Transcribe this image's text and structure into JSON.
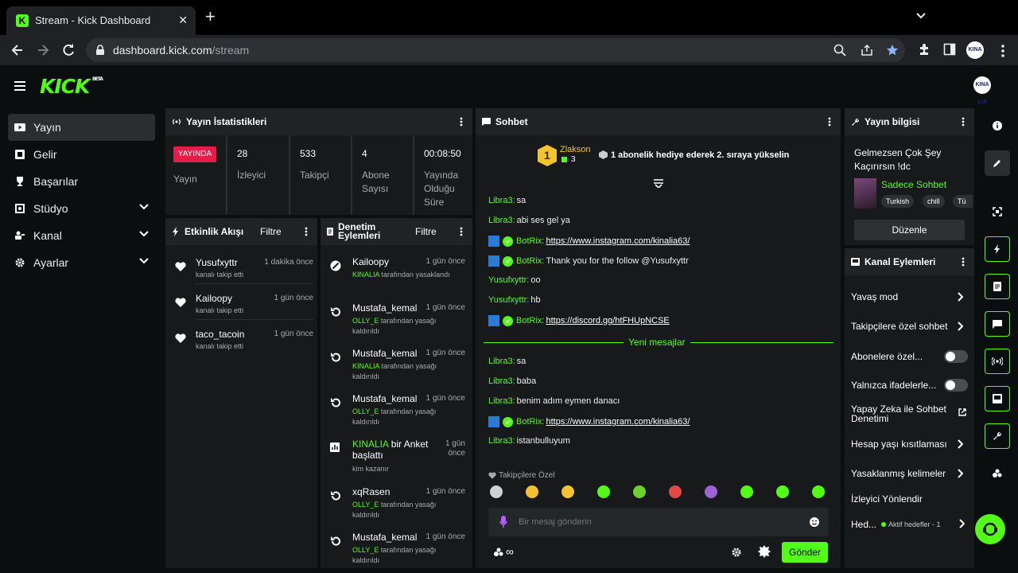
{
  "browser": {
    "tab_title": "Stream - Kick Dashboard",
    "tab_favicon": "K",
    "url_host": "dashboard.kick.com",
    "url_path": "/stream",
    "profile_initials": "KINA LIA"
  },
  "app": {
    "logo": "KICK",
    "logo_badge": "BETA",
    "avatar_initials": "KINA LIA",
    "accent": "#53fc18"
  },
  "sidebar": {
    "items": [
      {
        "label": "Yayın",
        "icon": "broadcast-icon"
      },
      {
        "label": "Gelir",
        "icon": "wallet-icon"
      },
      {
        "label": "Başarılar",
        "icon": "trophy-icon"
      },
      {
        "label": "Stüdyo",
        "icon": "studio-icon"
      },
      {
        "label": "Kanal",
        "icon": "users-icon"
      },
      {
        "label": "Ayarlar",
        "icon": "gear-icon"
      }
    ]
  },
  "stats": {
    "title": "Yayın İstatistikleri",
    "live_badge": "YAYINDA",
    "live_label": "Yayın",
    "viewers": "28",
    "viewers_label": "İzleyici",
    "followers": "533",
    "followers_label": "Takipçi",
    "subs": "4",
    "subs_label": "Abone Sayısı",
    "uptime": "00:08:50",
    "uptime_label": "Yayında Olduğu Süre"
  },
  "activity": {
    "title": "Etkinlik Akışı",
    "filter": "Filtre",
    "items": [
      {
        "name": "Yusufxyttr",
        "time": "1 dakika önce",
        "sub": "kanalı takip etti"
      },
      {
        "name": "Kailoopy",
        "time": "1 gün önce",
        "sub": "kanalı takip etti"
      },
      {
        "name": "taco_tacoin",
        "time": "1 gün önce",
        "sub": "kanalı takip etti"
      }
    ]
  },
  "moderation": {
    "title_line1": "Denetim",
    "title_line2": "Eylemleri",
    "filter": "Filtre",
    "items": [
      {
        "name": "Kailoopy",
        "time": "1 gün önce",
        "actor": "KINALIA",
        "action": " tarafından yasaklandı"
      },
      {
        "name": "Mustafa_kemal",
        "time": "1 gün önce",
        "actor": "OLLY_E",
        "action": " tarafından yasağı kaldırıldı"
      },
      {
        "name": "Mustafa_kemal",
        "time": "1 gün önce",
        "actor": "KINALIA",
        "action": " tarafından yasağı kaldırıldı"
      },
      {
        "name": "Mustafa_kemal",
        "time": "1 gün önce",
        "actor": "OLLY_E",
        "action": " tarafından yasağı kaldırıldı"
      },
      {
        "name_actor": "KINALIA",
        "name_rest": " bir Anket başlattı",
        "time": "1 gün önce",
        "sub": "kim kazanır"
      },
      {
        "name": "xqRasen",
        "time": "1 gün önce",
        "actor": "OLLY_E",
        "action": " tarafından yasağı kaldırıldı"
      },
      {
        "name": "Mustafa_kemal",
        "time": "1 gün önce",
        "actor": "OLLY_E",
        "action": " tarafından yasağı kaldırıldı"
      }
    ]
  },
  "chat": {
    "title": "Sohbet",
    "pinned_user": "Zlakson",
    "pinned_count": "3",
    "pinned_rank": "1",
    "pinned_msg": "1 abonelik hediye ederek 2. sıraya yükselin",
    "new_messages": "Yeni mesajlar",
    "followers_only": "Takipçilere Özel",
    "placeholder": "Bir mesaj gönderin",
    "send": "Gönder",
    "messages": [
      {
        "user": "Libra3:",
        "text": " sa"
      },
      {
        "user": "Libra3:",
        "text": " abi ses gel ya"
      },
      {
        "user": "BotRix:",
        "link": "https://www.instagram.com/kinalia63/",
        "bot": true
      },
      {
        "user": "BotRix:",
        "text": " Thank you for the follow @Yusufxyttr",
        "bot": true
      },
      {
        "user": "Yusufxyttr:",
        "text": " oo"
      },
      {
        "user": "Yusufxyttr:",
        "text": " hb"
      },
      {
        "user": "BotRix:",
        "link": "https://discord.gg/htFHUpNCSE",
        "bot": true
      },
      {
        "user": "Libra3:",
        "text": " sa"
      },
      {
        "user": "Libra3:",
        "text": " baba"
      },
      {
        "user": "Libra3:",
        "text": " benim adım eymen danacı"
      },
      {
        "user": "BotRix:",
        "link": "https://www.instagram.com/kinalia63/",
        "bot": true
      },
      {
        "user": "Libra3:",
        "text": " istanbulluyum"
      }
    ],
    "emote_colors": [
      "#d0d0d0",
      "#f2c230",
      "#f2c230",
      "#53fc18",
      "#6fd02d",
      "#e04848",
      "#9c63d6",
      "#53fc18",
      "#53fc18",
      "#53fc18"
    ]
  },
  "info": {
    "title": "Yayın bilgisi",
    "stream_title_l1": "Gelmezsen Çok Şey",
    "stream_title_l2": "Kaçırırsın !dc",
    "category": "Sadece Sohbet",
    "tags": [
      "Turkish",
      "chill",
      "Tü"
    ],
    "edit": "Düzenle"
  },
  "channel_actions": {
    "title": "Kanal Eylemleri",
    "slow": "Yavaş mod",
    "followers": "Takipçilere özel sohbet",
    "subs": "Abonelere özel...",
    "emotes": "Yalnızca ifadelerle...",
    "ai_l1": "Yapay Zeka ile Sohbet",
    "ai_l2": "Denetimi",
    "age": "Hesap yaşı kısıtlaması",
    "banned": "Yasaklanmış kelimeler",
    "host": "İzleyici Yönlendir",
    "goals": "Hed...",
    "goals_status": "Aktif hedefler - 1"
  }
}
